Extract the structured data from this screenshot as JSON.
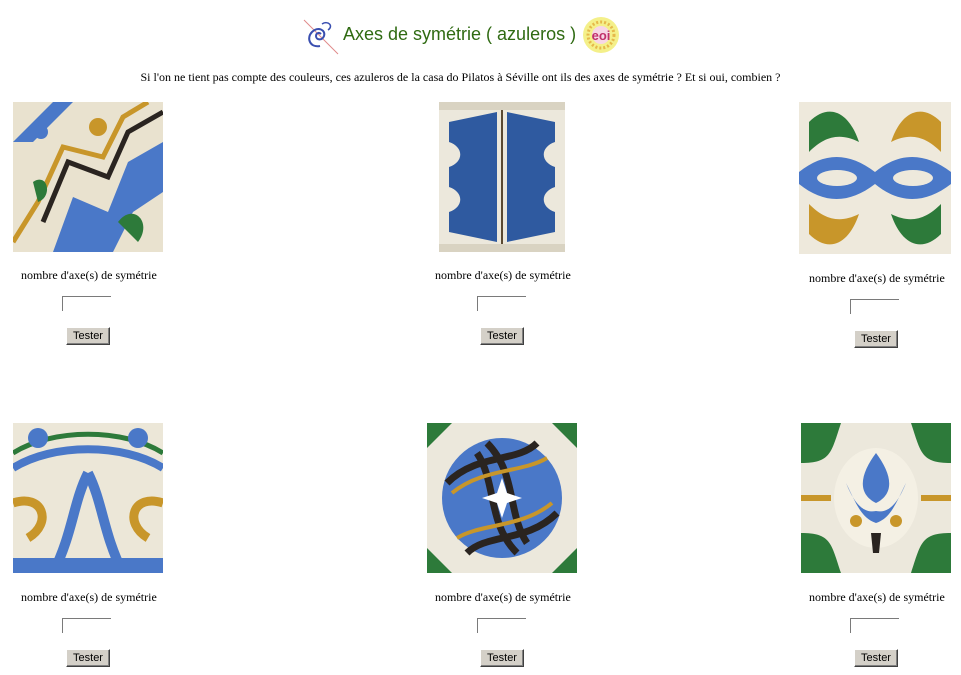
{
  "header": {
    "title": "Axes de symétrie ( azuleros )",
    "left_logo_icon": "spiral-logo-icon",
    "right_logo_icon": "eoi-logo-icon",
    "right_logo_text": "eoi"
  },
  "question": "Si l'on ne tient pas compte des couleurs, ces azuleros de la casa do Pilatos à Séville ont ils des axes de symétrie ? Et si oui, combien ?",
  "colors": {
    "title": "#2f6a12",
    "tile_blue": "#4a78c8",
    "tile_dark_blue": "#2a4f96",
    "tile_green": "#2d7a3a",
    "tile_ochre": "#c8962a",
    "tile_cream": "#efeadb",
    "tile_black": "#2a2420",
    "button_face": "#d4d0c8"
  },
  "tiles": [
    {
      "image": "azulejo-tile-1",
      "label": "nombre d'axe(s) de symétrie",
      "answer_value": "",
      "button": "Tester"
    },
    {
      "image": "azulejo-tile-2",
      "label": "nombre d'axe(s) de symétrie",
      "answer_value": "",
      "button": "Tester"
    },
    {
      "image": "azulejo-tile-3",
      "label": "nombre d'axe(s) de symétrie",
      "answer_value": "",
      "button": "Tester"
    },
    {
      "image": "azulejo-tile-4",
      "label": "nombre d'axe(s) de symétrie",
      "answer_value": "",
      "button": "Tester"
    },
    {
      "image": "azulejo-tile-5",
      "label": "nombre d'axe(s) de symétrie",
      "answer_value": "",
      "button": "Tester"
    },
    {
      "image": "azulejo-tile-6",
      "label": "nombre d'axe(s) de symétrie",
      "answer_value": "",
      "button": "Tester"
    }
  ]
}
